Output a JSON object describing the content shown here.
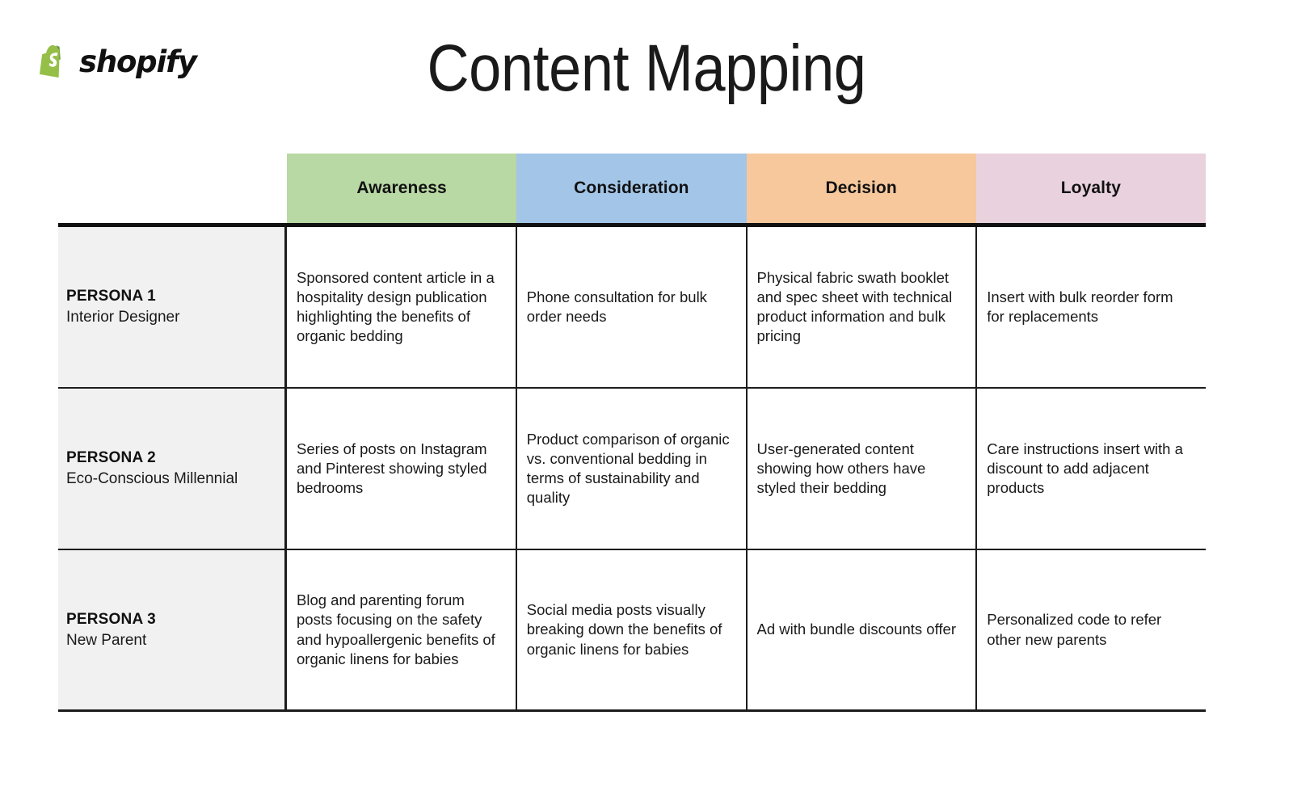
{
  "brand": {
    "logo_icon": "shopify-bag-icon",
    "wordmark": "shopify",
    "logo_green": "#95bf47",
    "logo_green_dark": "#5e8e3e"
  },
  "header": {
    "title": "Content Mapping"
  },
  "matrix": {
    "corner_label": "",
    "stages": [
      {
        "label": "Awareness",
        "color": "#b8d8a4"
      },
      {
        "label": "Consideration",
        "color": "#a3c6e8"
      },
      {
        "label": "Decision",
        "color": "#f7c89c"
      },
      {
        "label": "Loyalty",
        "color": "#e9d2de"
      }
    ],
    "rows": [
      {
        "persona_title": "PERSONA 1",
        "persona_sub": "Interior Designer",
        "cells": [
          "Sponsored content article in a hospitality design publication highlighting the benefits of organic bedding",
          "Phone consultation for bulk order needs",
          "Physical fabric swath booklet and spec sheet with technical product information and bulk pricing",
          "Insert with bulk reorder form for replacements"
        ]
      },
      {
        "persona_title": "PERSONA 2",
        "persona_sub": "Eco-Conscious Millennial",
        "cells": [
          "Series of posts on Instagram and Pinterest showing styled bedrooms",
          "Product comparison of organic vs. conventional bedding in terms of sustainability and quality",
          "User-generated content showing how others have styled their bedding",
          "Care instructions insert with a discount to add adjacent products"
        ]
      },
      {
        "persona_title": "PERSONA 3",
        "persona_sub": "New Parent",
        "cells": [
          "Blog and parenting forum posts focusing on the safety and hypoallergenic benefits of organic linens for babies",
          "Social media posts visually breaking down the benefits of organic linens for babies",
          "Ad with bundle discounts offer",
          "Personalized code to refer other new parents"
        ]
      }
    ]
  }
}
